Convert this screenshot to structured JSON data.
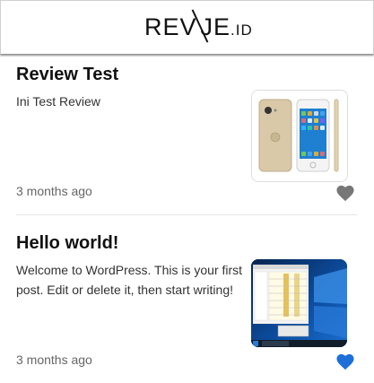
{
  "header": {
    "logo_main": "REV",
    "logo_tail": "JE",
    "logo_suffix": ".ID"
  },
  "posts": [
    {
      "title": "Review Test",
      "excerpt": "Ini Test Review",
      "date": "3 months ago",
      "liked": false,
      "heart_color": "#777777",
      "thumbnail": "iphone-photo"
    },
    {
      "title": "Hello world!",
      "excerpt": "Welcome to WordPress. This is your first post. Edit or delete it, then start writing!",
      "date": "3 months ago",
      "liked": true,
      "heart_color": "#1e6fd9",
      "thumbnail": "windows-desktop-screenshot"
    }
  ],
  "colors": {
    "liked": "#1e6fd9",
    "unliked": "#777777"
  }
}
